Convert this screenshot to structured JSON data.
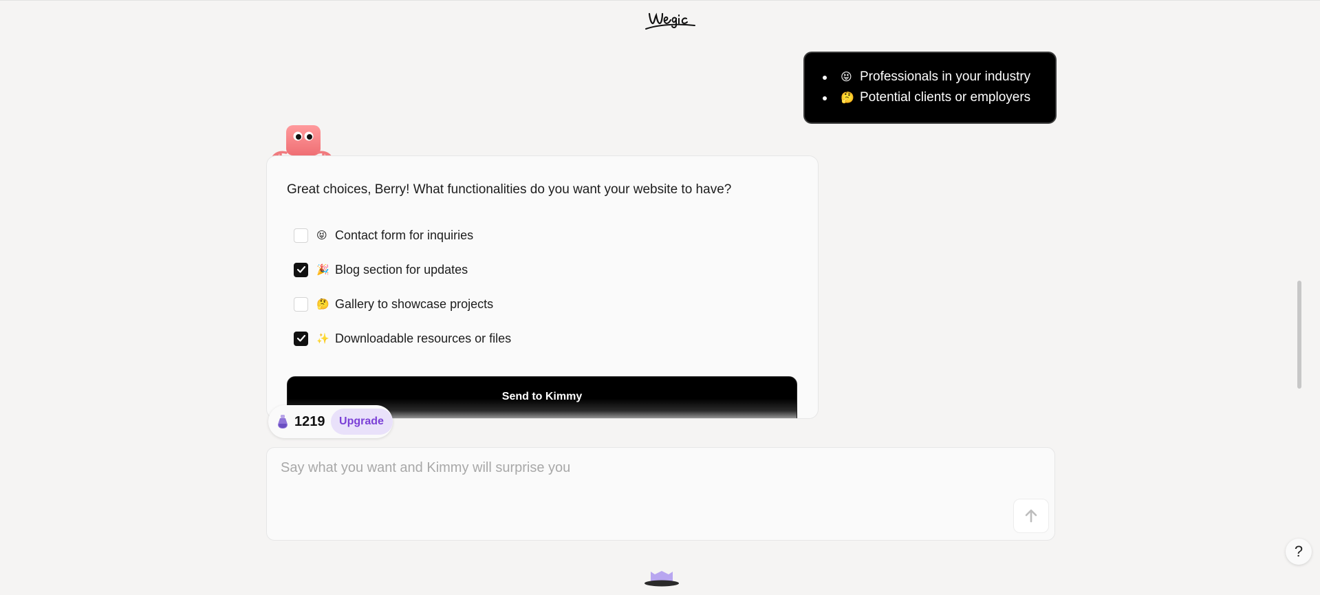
{
  "brand": {
    "logo_text": "Wegic"
  },
  "user_message": {
    "items": [
      {
        "emoji": "😝",
        "text": "Professionals in your industry"
      },
      {
        "emoji": "🤔",
        "text": "Potential clients or employers"
      }
    ]
  },
  "assistant_card": {
    "question": "Great choices, Berry! What functionalities do you want your website to have?",
    "options": [
      {
        "emoji": "😝",
        "label": "Contact form for inquiries",
        "checked": false
      },
      {
        "emoji": "🎉",
        "label": "Blog section for updates",
        "checked": true
      },
      {
        "emoji": "🤔",
        "label": "Gallery to showcase projects",
        "checked": false
      },
      {
        "emoji": "✨",
        "label": "Downloadable resources or files",
        "checked": true
      }
    ],
    "send_button_label": "Send to Kimmy"
  },
  "credits": {
    "count": "1219",
    "upgrade_label": "Upgrade"
  },
  "composer": {
    "placeholder": "Say what you want and Kimmy will surprise you",
    "value": ""
  },
  "help": {
    "label": "?"
  },
  "colors": {
    "accent_purple": "#7a3fd6",
    "upgrade_bg": "#e9e1fa",
    "mascot_pink": "#f07a7e"
  }
}
